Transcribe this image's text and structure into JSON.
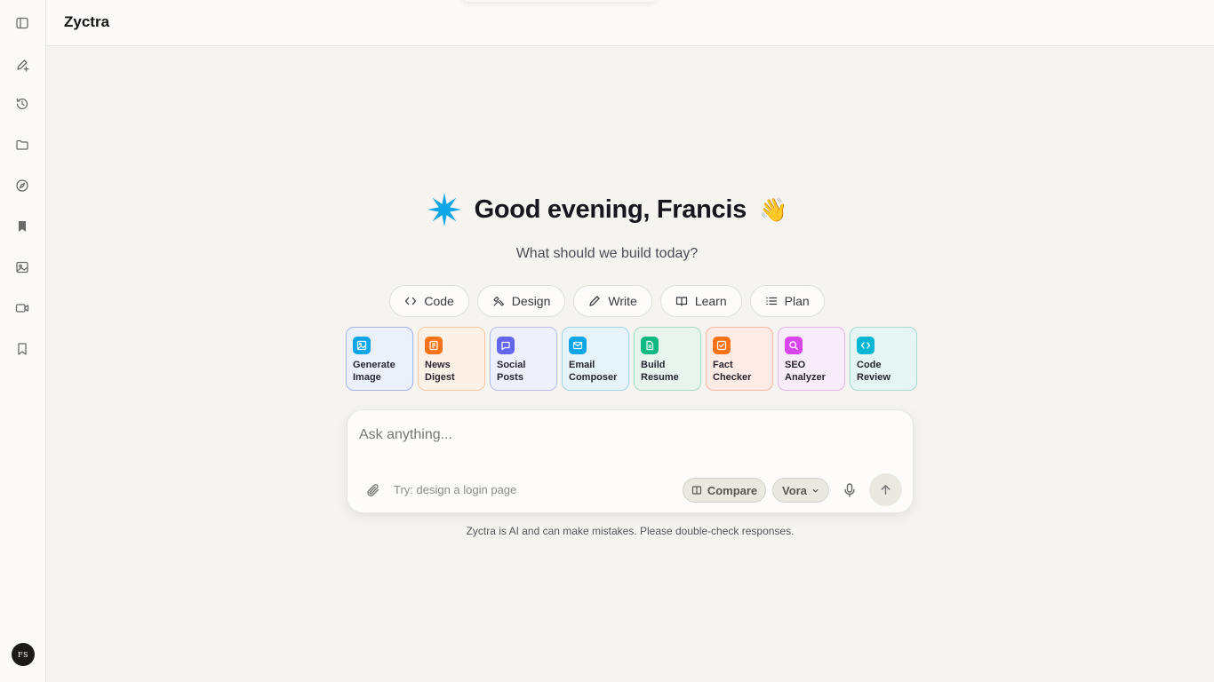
{
  "app": {
    "name": "Zyctra"
  },
  "user": {
    "initials": "FS"
  },
  "sidebar": {
    "items": [
      {
        "name": "toggle-sidebar",
        "icon": "sidebar-icon"
      },
      {
        "name": "new-chat",
        "icon": "new-chat-icon"
      },
      {
        "name": "history",
        "icon": "history-icon"
      },
      {
        "name": "folders",
        "icon": "folder-icon"
      },
      {
        "name": "explore",
        "icon": "compass-icon"
      },
      {
        "name": "saved",
        "icon": "bookmark-filled-icon"
      },
      {
        "name": "images",
        "icon": "image-icon"
      },
      {
        "name": "videos",
        "icon": "video-icon"
      },
      {
        "name": "bookmarks",
        "icon": "bookmark-icon"
      }
    ]
  },
  "greeting": {
    "text": "Good evening, Francis",
    "emoji": "👋"
  },
  "subtitle": "What should we build today?",
  "modes": [
    {
      "label": "Code",
      "icon": "code-icon"
    },
    {
      "label": "Design",
      "icon": "palette-icon"
    },
    {
      "label": "Write",
      "icon": "pencil-icon"
    },
    {
      "label": "Learn",
      "icon": "book-icon"
    },
    {
      "label": "Plan",
      "icon": "list-icon"
    }
  ],
  "tools": [
    {
      "line1": "Generate",
      "line2": "Image",
      "icon": "image-icon",
      "color": "#0ea5e9",
      "bg": "#eaf1fb",
      "border": "#a5b4e9"
    },
    {
      "line1": "News",
      "line2": "Digest",
      "icon": "newspaper-icon",
      "color": "#f97316",
      "bg": "#fdf0e6",
      "border": "#f5c9a0"
    },
    {
      "line1": "Social",
      "line2": "Posts",
      "icon": "chat-icon",
      "color": "#6366f1",
      "bg": "#eef0fb",
      "border": "#b7bdea"
    },
    {
      "line1": "Email",
      "line2": "Composer",
      "icon": "mail-icon",
      "color": "#0ea5e9",
      "bg": "#e6f4f9",
      "border": "#9fd4e6"
    },
    {
      "line1": "Build",
      "line2": "Resume",
      "icon": "document-icon",
      "color": "#10b981",
      "bg": "#e8f5ef",
      "border": "#a8dcc4"
    },
    {
      "line1": "Fact",
      "line2": "Checker",
      "icon": "check-square-icon",
      "color": "#f97316",
      "bg": "#fdebe6",
      "border": "#f5b7a8"
    },
    {
      "line1": "SEO",
      "line2": "Analyzer",
      "icon": "search-icon",
      "color": "#d946ef",
      "bg": "#f8ecf8",
      "border": "#e2b5e6"
    },
    {
      "line1": "Code",
      "line2": "Review",
      "icon": "code-icon",
      "color": "#06b6d4",
      "bg": "#e4f5f3",
      "border": "#a5dcd4"
    }
  ],
  "composer": {
    "placeholder": "Ask anything...",
    "hint": "Try: design a login page",
    "compare_label": "Compare",
    "model_label": "Vora"
  },
  "disclaimer": "Zyctra is AI and can make mistakes. Please double-check responses."
}
